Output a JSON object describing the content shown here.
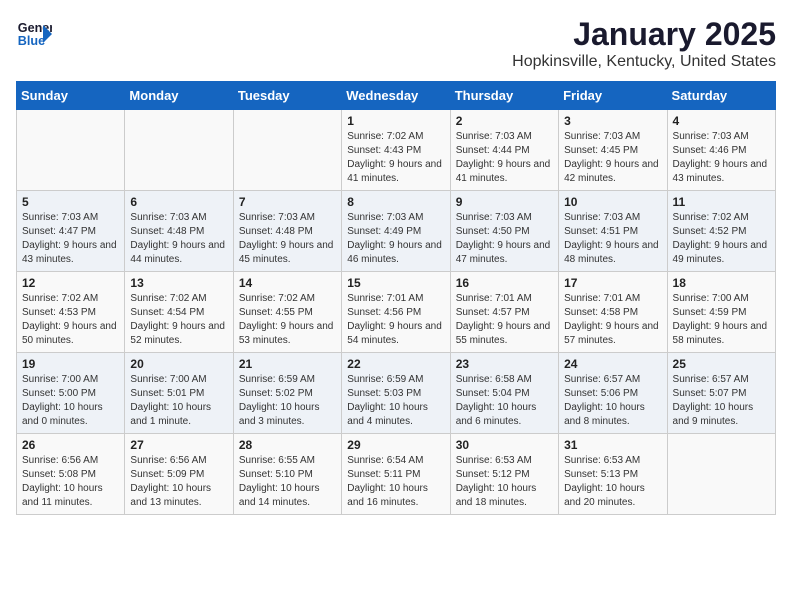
{
  "header": {
    "logo_line1": "General",
    "logo_line2": "Blue",
    "title": "January 2025",
    "subtitle": "Hopkinsville, Kentucky, United States"
  },
  "days_of_week": [
    "Sunday",
    "Monday",
    "Tuesday",
    "Wednesday",
    "Thursday",
    "Friday",
    "Saturday"
  ],
  "weeks": [
    [
      {
        "day": "",
        "info": ""
      },
      {
        "day": "",
        "info": ""
      },
      {
        "day": "",
        "info": ""
      },
      {
        "day": "1",
        "info": "Sunrise: 7:02 AM\nSunset: 4:43 PM\nDaylight: 9 hours and 41 minutes."
      },
      {
        "day": "2",
        "info": "Sunrise: 7:03 AM\nSunset: 4:44 PM\nDaylight: 9 hours and 41 minutes."
      },
      {
        "day": "3",
        "info": "Sunrise: 7:03 AM\nSunset: 4:45 PM\nDaylight: 9 hours and 42 minutes."
      },
      {
        "day": "4",
        "info": "Sunrise: 7:03 AM\nSunset: 4:46 PM\nDaylight: 9 hours and 43 minutes."
      }
    ],
    [
      {
        "day": "5",
        "info": "Sunrise: 7:03 AM\nSunset: 4:47 PM\nDaylight: 9 hours and 43 minutes."
      },
      {
        "day": "6",
        "info": "Sunrise: 7:03 AM\nSunset: 4:48 PM\nDaylight: 9 hours and 44 minutes."
      },
      {
        "day": "7",
        "info": "Sunrise: 7:03 AM\nSunset: 4:48 PM\nDaylight: 9 hours and 45 minutes."
      },
      {
        "day": "8",
        "info": "Sunrise: 7:03 AM\nSunset: 4:49 PM\nDaylight: 9 hours and 46 minutes."
      },
      {
        "day": "9",
        "info": "Sunrise: 7:03 AM\nSunset: 4:50 PM\nDaylight: 9 hours and 47 minutes."
      },
      {
        "day": "10",
        "info": "Sunrise: 7:03 AM\nSunset: 4:51 PM\nDaylight: 9 hours and 48 minutes."
      },
      {
        "day": "11",
        "info": "Sunrise: 7:02 AM\nSunset: 4:52 PM\nDaylight: 9 hours and 49 minutes."
      }
    ],
    [
      {
        "day": "12",
        "info": "Sunrise: 7:02 AM\nSunset: 4:53 PM\nDaylight: 9 hours and 50 minutes."
      },
      {
        "day": "13",
        "info": "Sunrise: 7:02 AM\nSunset: 4:54 PM\nDaylight: 9 hours and 52 minutes."
      },
      {
        "day": "14",
        "info": "Sunrise: 7:02 AM\nSunset: 4:55 PM\nDaylight: 9 hours and 53 minutes."
      },
      {
        "day": "15",
        "info": "Sunrise: 7:01 AM\nSunset: 4:56 PM\nDaylight: 9 hours and 54 minutes."
      },
      {
        "day": "16",
        "info": "Sunrise: 7:01 AM\nSunset: 4:57 PM\nDaylight: 9 hours and 55 minutes."
      },
      {
        "day": "17",
        "info": "Sunrise: 7:01 AM\nSunset: 4:58 PM\nDaylight: 9 hours and 57 minutes."
      },
      {
        "day": "18",
        "info": "Sunrise: 7:00 AM\nSunset: 4:59 PM\nDaylight: 9 hours and 58 minutes."
      }
    ],
    [
      {
        "day": "19",
        "info": "Sunrise: 7:00 AM\nSunset: 5:00 PM\nDaylight: 10 hours and 0 minutes."
      },
      {
        "day": "20",
        "info": "Sunrise: 7:00 AM\nSunset: 5:01 PM\nDaylight: 10 hours and 1 minute."
      },
      {
        "day": "21",
        "info": "Sunrise: 6:59 AM\nSunset: 5:02 PM\nDaylight: 10 hours and 3 minutes."
      },
      {
        "day": "22",
        "info": "Sunrise: 6:59 AM\nSunset: 5:03 PM\nDaylight: 10 hours and 4 minutes."
      },
      {
        "day": "23",
        "info": "Sunrise: 6:58 AM\nSunset: 5:04 PM\nDaylight: 10 hours and 6 minutes."
      },
      {
        "day": "24",
        "info": "Sunrise: 6:57 AM\nSunset: 5:06 PM\nDaylight: 10 hours and 8 minutes."
      },
      {
        "day": "25",
        "info": "Sunrise: 6:57 AM\nSunset: 5:07 PM\nDaylight: 10 hours and 9 minutes."
      }
    ],
    [
      {
        "day": "26",
        "info": "Sunrise: 6:56 AM\nSunset: 5:08 PM\nDaylight: 10 hours and 11 minutes."
      },
      {
        "day": "27",
        "info": "Sunrise: 6:56 AM\nSunset: 5:09 PM\nDaylight: 10 hours and 13 minutes."
      },
      {
        "day": "28",
        "info": "Sunrise: 6:55 AM\nSunset: 5:10 PM\nDaylight: 10 hours and 14 minutes."
      },
      {
        "day": "29",
        "info": "Sunrise: 6:54 AM\nSunset: 5:11 PM\nDaylight: 10 hours and 16 minutes."
      },
      {
        "day": "30",
        "info": "Sunrise: 6:53 AM\nSunset: 5:12 PM\nDaylight: 10 hours and 18 minutes."
      },
      {
        "day": "31",
        "info": "Sunrise: 6:53 AM\nSunset: 5:13 PM\nDaylight: 10 hours and 20 minutes."
      },
      {
        "day": "",
        "info": ""
      }
    ]
  ]
}
